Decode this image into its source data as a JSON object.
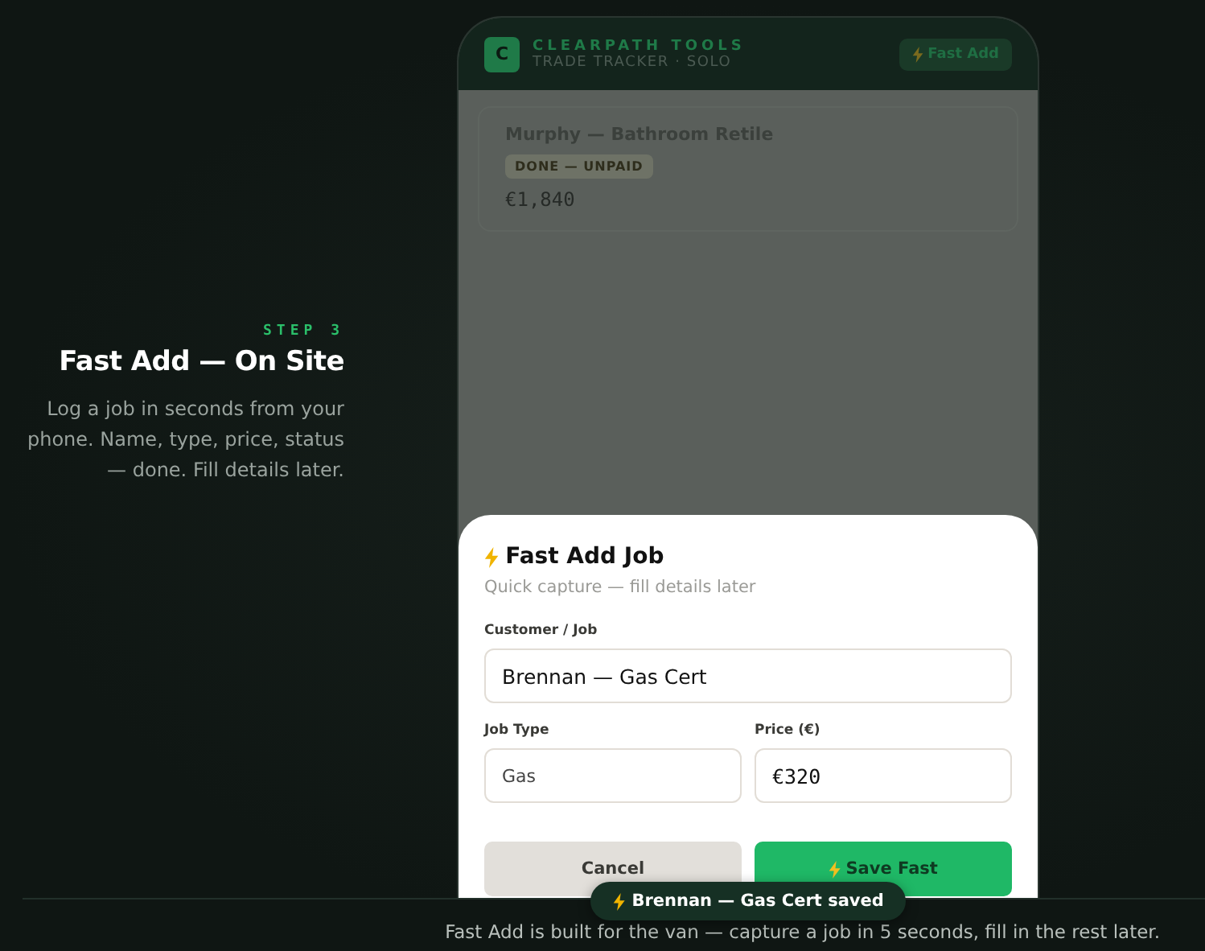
{
  "intro": {
    "step": "STEP 3",
    "title": "Fast Add — On Site",
    "description": "Log a job in seconds from your phone. Name, type, price, status — done. Fill details later."
  },
  "app": {
    "brand_letter": "C",
    "brand": "CLEARPATH TOOLS",
    "subtitle": "TRADE TRACKER · SOLO",
    "fast_add_button": "Fast Add"
  },
  "jobs": [
    {
      "title": "Murphy — Bathroom Retile",
      "status": "DONE — UNPAID",
      "price": "€1,840"
    }
  ],
  "sheet": {
    "title": "Fast Add Job",
    "subtitle": "Quick capture — fill details later",
    "fields": [
      {
        "label": "Customer / Job",
        "value": "Brennan — Gas Cert",
        "mono": false
      },
      {
        "label": "Job Type",
        "value": "Gas",
        "mono": false
      },
      {
        "label": "Price (€)",
        "value": "€320",
        "mono": true
      }
    ],
    "buttons": [
      {
        "label": "Cancel",
        "kind": "secondary"
      },
      {
        "label": "Save Fast",
        "kind": "primary"
      }
    ]
  },
  "toast": "Brennan — Gas Cert saved",
  "footer": "Fast Add is built for the van — capture a job in 5 seconds, fill in the rest later."
}
